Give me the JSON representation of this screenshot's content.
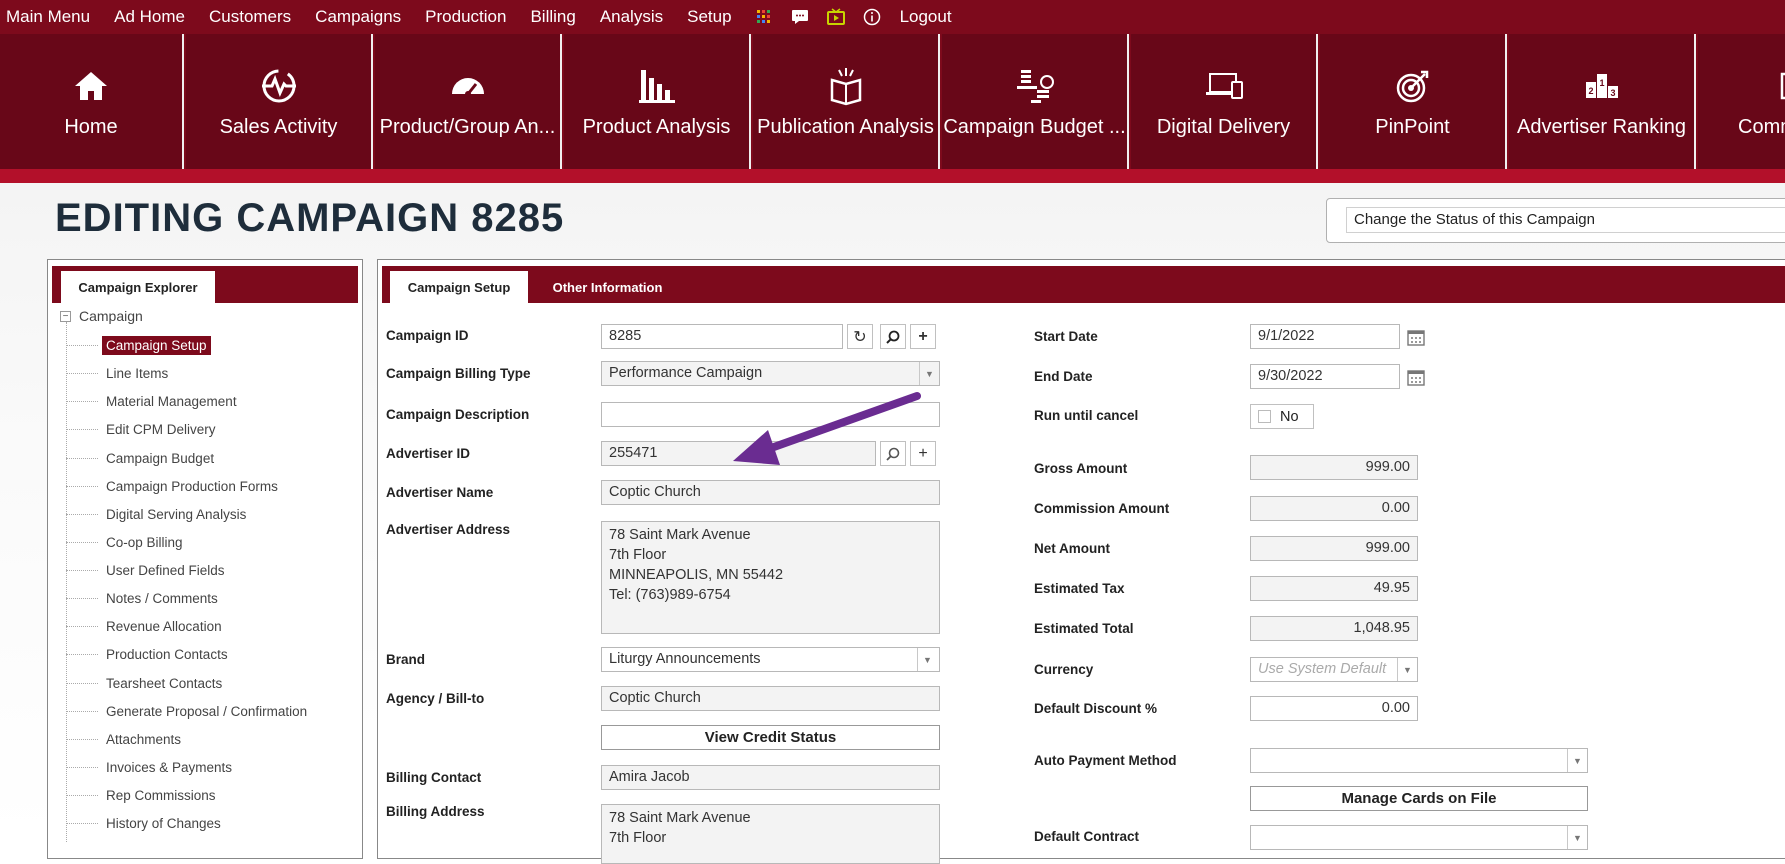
{
  "top_menu": {
    "items": [
      "Main Menu",
      "Ad Home",
      "Customers",
      "Campaigns",
      "Production",
      "Billing",
      "Analysis",
      "Setup"
    ],
    "icons": [
      "apps-grid-icon",
      "chat-icon",
      "tv-icon",
      "info-icon"
    ],
    "logout": "Logout"
  },
  "tiles": [
    {
      "label": "Home",
      "icon": "home-icon"
    },
    {
      "label": "Sales Activity",
      "icon": "heartbeat-icon"
    },
    {
      "label": "Product/Group An...",
      "icon": "gauge-icon"
    },
    {
      "label": "Product Analysis",
      "icon": "bar-chart-icon"
    },
    {
      "label": "Publication Analysis",
      "icon": "open-book-icon"
    },
    {
      "label": "Campaign Budget ...",
      "icon": "coins-icon"
    },
    {
      "label": "Digital Delivery",
      "icon": "devices-icon"
    },
    {
      "label": "PinPoint",
      "icon": "target-icon"
    },
    {
      "label": "Advertiser Ranking",
      "icon": "podium-icon"
    },
    {
      "label": "Comm",
      "icon": "commission-icon"
    }
  ],
  "page": {
    "title": "EDITING CAMPAIGN 8285",
    "status_select": "Change the Status of this Campaign"
  },
  "explorer": {
    "tab": "Campaign Explorer",
    "root": "Campaign",
    "items": [
      "Campaign Setup",
      "Line Items",
      "Material Management",
      "Edit CPM Delivery",
      "Campaign Budget",
      "Campaign Production Forms",
      "Digital Serving Analysis",
      "Co-op Billing",
      "User Defined Fields",
      "Notes / Comments",
      "Revenue Allocation",
      "Production Contacts",
      "Tearsheet Contacts",
      "Generate Proposal / Confirmation",
      "Attachments",
      "Invoices & Payments",
      "Rep Commissions",
      "History of Changes"
    ],
    "selected": "Campaign Setup"
  },
  "tabs": {
    "active": "Campaign Setup",
    "other": "Other Information"
  },
  "form_left": {
    "campaign_id_label": "Campaign ID",
    "campaign_id": "8285",
    "billing_type_label": "Campaign Billing Type",
    "billing_type": "Performance Campaign",
    "description_label": "Campaign Description",
    "description": "",
    "advertiser_id_label": "Advertiser ID",
    "advertiser_id": "255471",
    "advertiser_name_label": "Advertiser Name",
    "advertiser_name": "Coptic Church",
    "advertiser_address_label": "Advertiser Address",
    "advertiser_address": [
      "78 Saint Mark Avenue",
      "7th Floor",
      "MINNEAPOLIS, MN 55442",
      "Tel: (763)989-6754"
    ],
    "brand_label": "Brand",
    "brand": "Liturgy Announcements",
    "agency_label": "Agency / Bill-to",
    "agency": "Coptic Church",
    "credit_button": "View Credit Status",
    "billing_contact_label": "Billing Contact",
    "billing_contact": "Amira Jacob",
    "billing_address_label": "Billing Address",
    "billing_address": [
      "78 Saint Mark Avenue",
      "7th Floor"
    ]
  },
  "form_right": {
    "start_date_label": "Start Date",
    "start_date": "9/1/2022",
    "end_date_label": "End Date",
    "end_date": "9/30/2022",
    "run_until_cancel_label": "Run until cancel",
    "run_until_cancel": "No",
    "gross_label": "Gross Amount",
    "gross": "999.00",
    "commission_label": "Commission Amount",
    "commission": "0.00",
    "net_label": "Net Amount",
    "net": "999.00",
    "tax_label": "Estimated Tax",
    "tax": "49.95",
    "total_label": "Estimated Total",
    "total": "1,048.95",
    "currency_label": "Currency",
    "currency_placeholder": "Use System Default",
    "discount_label": "Default Discount %",
    "discount": "0.00",
    "auto_payment_label": "Auto Payment Method",
    "auto_payment": "",
    "cards_button": "Manage Cards on File",
    "contract_label": "Default Contract"
  },
  "colors": {
    "brand_dark": "#7d0a1c",
    "tile_bg": "#680718",
    "strip": "#b3102a",
    "arrow": "#6a2c91"
  }
}
